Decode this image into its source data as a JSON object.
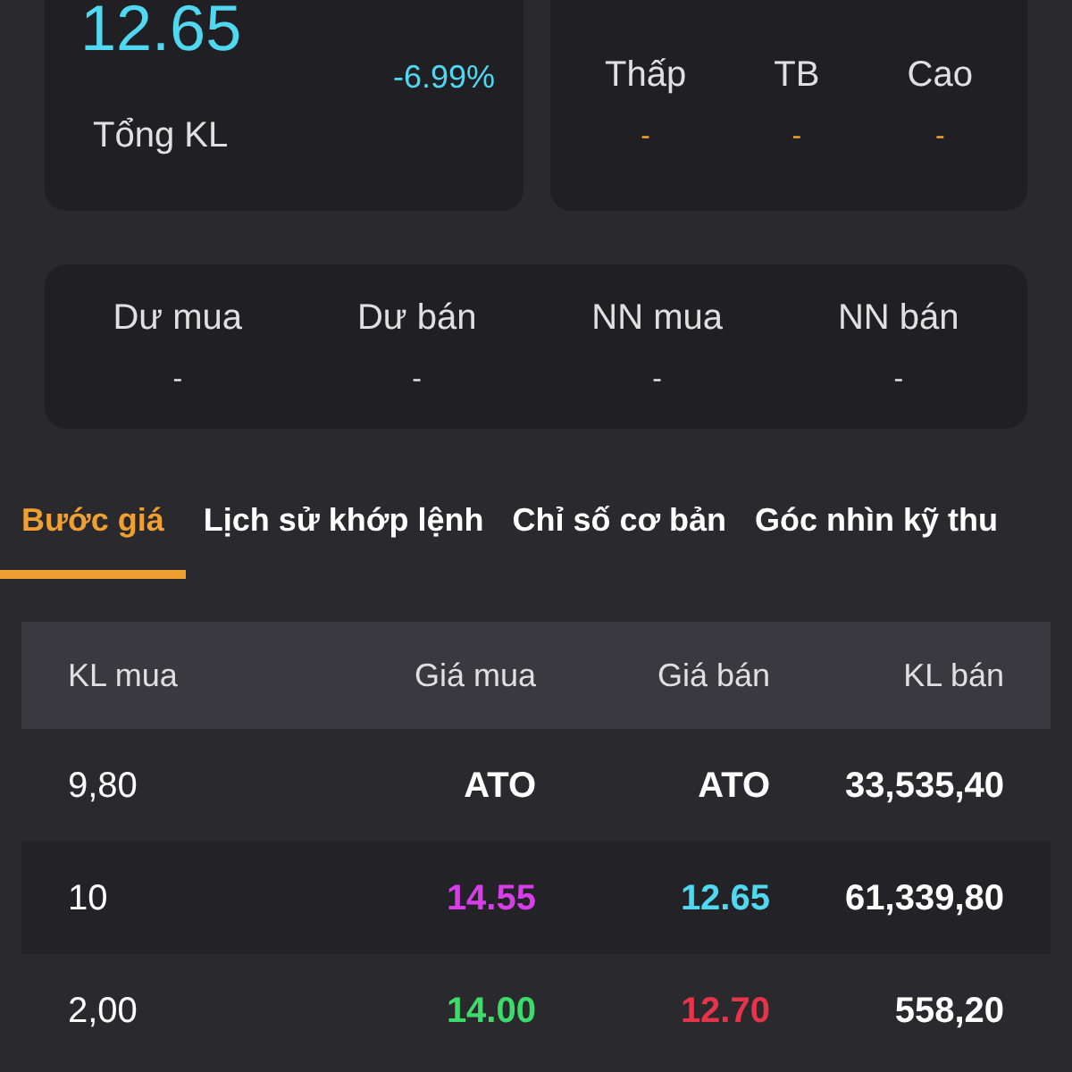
{
  "price_card": {
    "price": "12.65",
    "change_percent": "-6.99%",
    "volume_label": "Tổng KL"
  },
  "range_card": {
    "items": [
      {
        "label": "Thấp",
        "value": "-"
      },
      {
        "label": "TB",
        "value": "-"
      },
      {
        "label": "Cao",
        "value": "-"
      }
    ]
  },
  "order_summary": [
    {
      "label": "Dư mua",
      "value": "-"
    },
    {
      "label": "Dư bán",
      "value": "-"
    },
    {
      "label": "NN mua",
      "value": "-"
    },
    {
      "label": "NN bán",
      "value": "-"
    }
  ],
  "tabs": [
    {
      "label": "Bước giá",
      "selected": true
    },
    {
      "label": "Lịch sử khớp lệnh",
      "selected": false
    },
    {
      "label": "Chỉ số cơ bản",
      "selected": false
    },
    {
      "label": "Góc nhìn kỹ thu",
      "selected": false
    }
  ],
  "table": {
    "columns": [
      "KL mua",
      "Giá mua",
      "Giá bán",
      "KL bán"
    ],
    "rows": [
      {
        "cells": [
          {
            "text": "9,80",
            "color": "#ffffff"
          },
          {
            "text": "ATO",
            "color": "#ffffff"
          },
          {
            "text": "ATO",
            "color": "#ffffff"
          },
          {
            "text": "33,535,40",
            "color": "#ffffff"
          }
        ]
      },
      {
        "cells": [
          {
            "text": "10",
            "color": "#ffffff"
          },
          {
            "text": "14.55",
            "color": "#d63ee8"
          },
          {
            "text": "12.65",
            "color": "#4fd8f0"
          },
          {
            "text": "61,339,80",
            "color": "#ffffff"
          }
        ]
      },
      {
        "cells": [
          {
            "text": "2,00",
            "color": "#ffffff"
          },
          {
            "text": "14.00",
            "color": "#3ddc6a"
          },
          {
            "text": "12.70",
            "color": "#e8344a"
          },
          {
            "text": "558,20",
            "color": "#ffffff"
          }
        ]
      }
    ]
  }
}
